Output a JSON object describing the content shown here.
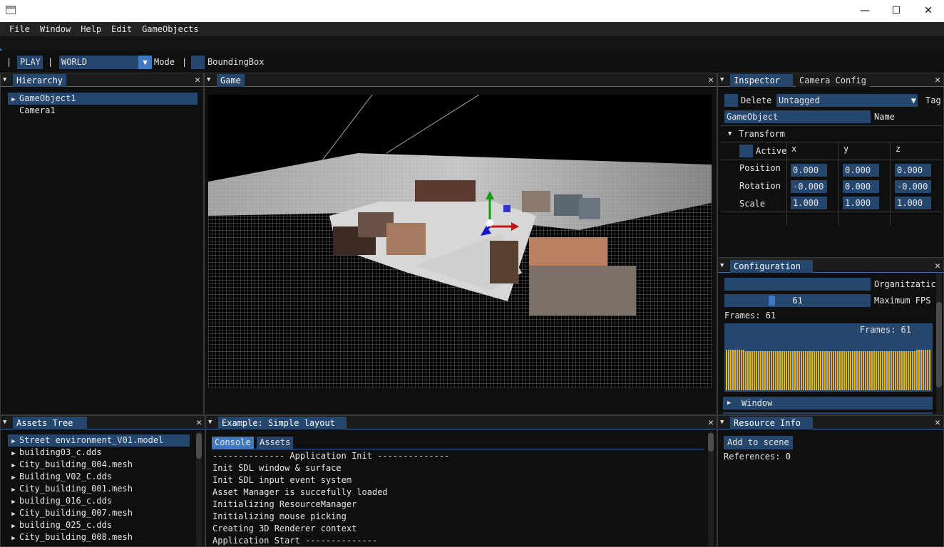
{
  "window": {
    "controls": {
      "minimize": "—",
      "maximize": "☐",
      "close": "✕"
    }
  },
  "menu": [
    "File",
    "Window",
    "Help",
    "Edit",
    "GameObjects"
  ],
  "toolbar": {
    "sep1": "|",
    "play": "PLAY",
    "sep2": "|",
    "mode_value": "WORLD",
    "mode_label": "Mode",
    "sep3": "|",
    "bounding_label": "BoundingBox"
  },
  "hierarchy": {
    "title": "Hierarchy",
    "items": [
      {
        "label": "GameObject1",
        "expandable": true,
        "selected": true
      },
      {
        "label": "Camera1",
        "expandable": false,
        "selected": false
      }
    ]
  },
  "game": {
    "title": "Game"
  },
  "inspector": {
    "tabs": [
      "Inspector",
      "Camera Config"
    ],
    "delete_label": "Delete",
    "tag_value": "Untagged",
    "tag_label": "Tag",
    "name_value": "GameObject",
    "name_label": "Name",
    "transform_label": "Transform",
    "active_label": "Active",
    "axes": [
      "x",
      "y",
      "z"
    ],
    "rows": [
      {
        "label": "Position",
        "x": "0.000",
        "y": "0.000",
        "z": "0.000"
      },
      {
        "label": "Rotation",
        "x": "-0.000",
        "y": "0.000",
        "z": "-0.000"
      },
      {
        "label": "Scale",
        "x": "1.000",
        "y": "1.000",
        "z": "1.000"
      }
    ]
  },
  "configuration": {
    "title": "Configuration",
    "org_label": "Organitzatic",
    "fps_value": "61",
    "fps_label": "Maximum FPS",
    "fps_fraction": 0.3,
    "frames_text": "Frames: 61",
    "histogram_overlay": "Frames: 61",
    "histogram_color": "#e6b419",
    "histogram_values": [
      0.95,
      0.95,
      0.95,
      0.95,
      0.95,
      0.95,
      0.95,
      0.95,
      0.95,
      0.92,
      0.92,
      0.92,
      0.92,
      0.92,
      0.92,
      0.92,
      0.92,
      0.92,
      0.92,
      0.92,
      0.92,
      0.92,
      0.92,
      0.92,
      0.92,
      0.92,
      0.92,
      0.92,
      0.92,
      0.92,
      0.92,
      0.92,
      0.92,
      0.92,
      0.92,
      0.92,
      0.92,
      0.92,
      0.92,
      0.92,
      0.92,
      0.92,
      0.92,
      0.92,
      0.92,
      0.92,
      0.92,
      0.92,
      0.92,
      0.92,
      0.92,
      0.92,
      0.92,
      0.92,
      0.92,
      0.92,
      0.92,
      0.92,
      0.92,
      0.92,
      0.92,
      0.92,
      0.92,
      0.92,
      0.92,
      0.92,
      0.92,
      0.92,
      0.92,
      0.92,
      0.92,
      0.92,
      0.92,
      0.92,
      0.92,
      0.92,
      0.92,
      0.92,
      0.92,
      0.92,
      0.92,
      0.92,
      0.92,
      0.92,
      0.92,
      0.92,
      0.92,
      0.92,
      0.92,
      0.95,
      0.95,
      0.95,
      0.95,
      0.95,
      0.95,
      0.95
    ],
    "window_header": "Window"
  },
  "assets_tree": {
    "title": "Assets Tree",
    "items": [
      {
        "label": "Street environment_V01.model",
        "selected": true
      },
      {
        "label": "building03_c.dds",
        "selected": false
      },
      {
        "label": "City_building_004.mesh",
        "selected": false
      },
      {
        "label": "Building_V02_C.dds",
        "selected": false
      },
      {
        "label": "City_building_001.mesh",
        "selected": false
      },
      {
        "label": "building_016_c.dds",
        "selected": false
      },
      {
        "label": "City_building_007.mesh",
        "selected": false
      },
      {
        "label": "building_025_c.dds",
        "selected": false
      },
      {
        "label": "City_building_008.mesh",
        "selected": false
      }
    ]
  },
  "layout": {
    "title": "Example: Simple layout",
    "tabs": [
      "Console",
      "Assets"
    ],
    "console_lines": [
      "-------------- Application Init --------------",
      "Init SDL window & surface",
      "Init SDL input event system",
      "Asset Manager is succefully loaded",
      "Initializing ResourceManager",
      "Initializing mouse picking",
      "Creating 3D Renderer context",
      "Application Start --------------"
    ]
  },
  "resource_info": {
    "title": "Resource Info",
    "add_button": "Add to scene",
    "references": "References: 0"
  },
  "colors": {
    "accent": "#25466d",
    "accent_bright": "#3f79c0",
    "panel_bg": "#0f0f0f",
    "header_bg": "#1b1b1b"
  }
}
